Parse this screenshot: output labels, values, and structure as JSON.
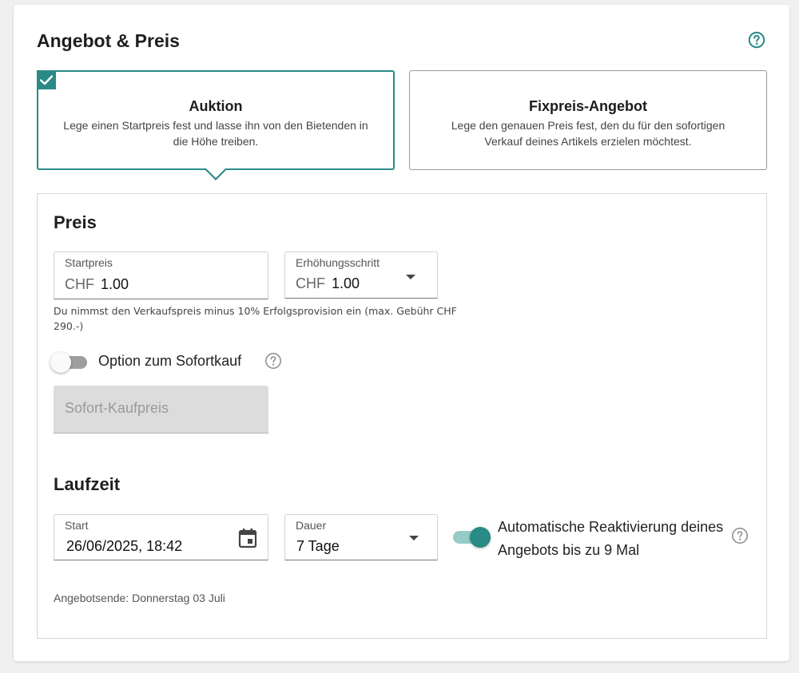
{
  "section": {
    "title": "Angebot & Preis",
    "help_icon": "question-circle-icon"
  },
  "offer_types": [
    {
      "title": "Auktion",
      "description": "Lege einen Startpreis fest und lasse ihn von den Bietenden in die Höhe treiben.",
      "selected": true
    },
    {
      "title": "Fixpreis-Angebot",
      "description": "Lege den genauen Preis fest, den du für den sofortigen Verkauf deines Artikels erzielen möchtest.",
      "selected": false
    }
  ],
  "price": {
    "heading": "Preis",
    "start_price": {
      "label": "Startpreis",
      "currency": "CHF",
      "value": "1.00"
    },
    "increment": {
      "label": "Erhöhungsschritt",
      "currency": "CHF",
      "value": "1.00"
    },
    "hint": "Du nimmst den Verkaufspreis minus 10% Erfolgsprovision ein (max. Gebühr CHF 290.-)",
    "buy_now": {
      "label": "Option zum Sofortkauf",
      "enabled": false
    },
    "buy_now_price_placeholder": "Sofort-Kaufpreis"
  },
  "duration": {
    "heading": "Laufzeit",
    "start": {
      "label": "Start",
      "value": "26/06/2025, 18:42"
    },
    "length": {
      "label": "Dauer",
      "value": "7 Tage"
    },
    "auto_relist": {
      "label": "Automatische Reaktivierung deines Angebots bis zu 9 Mal",
      "enabled": true
    },
    "end_text": "Angebotsende: Donnerstag 03 Juli"
  },
  "colors": {
    "accent": "#2a8a85",
    "accent_light": "#97cbc7",
    "switch_off": "#9e9e9e",
    "disabled_bg": "#dcdcdc"
  }
}
